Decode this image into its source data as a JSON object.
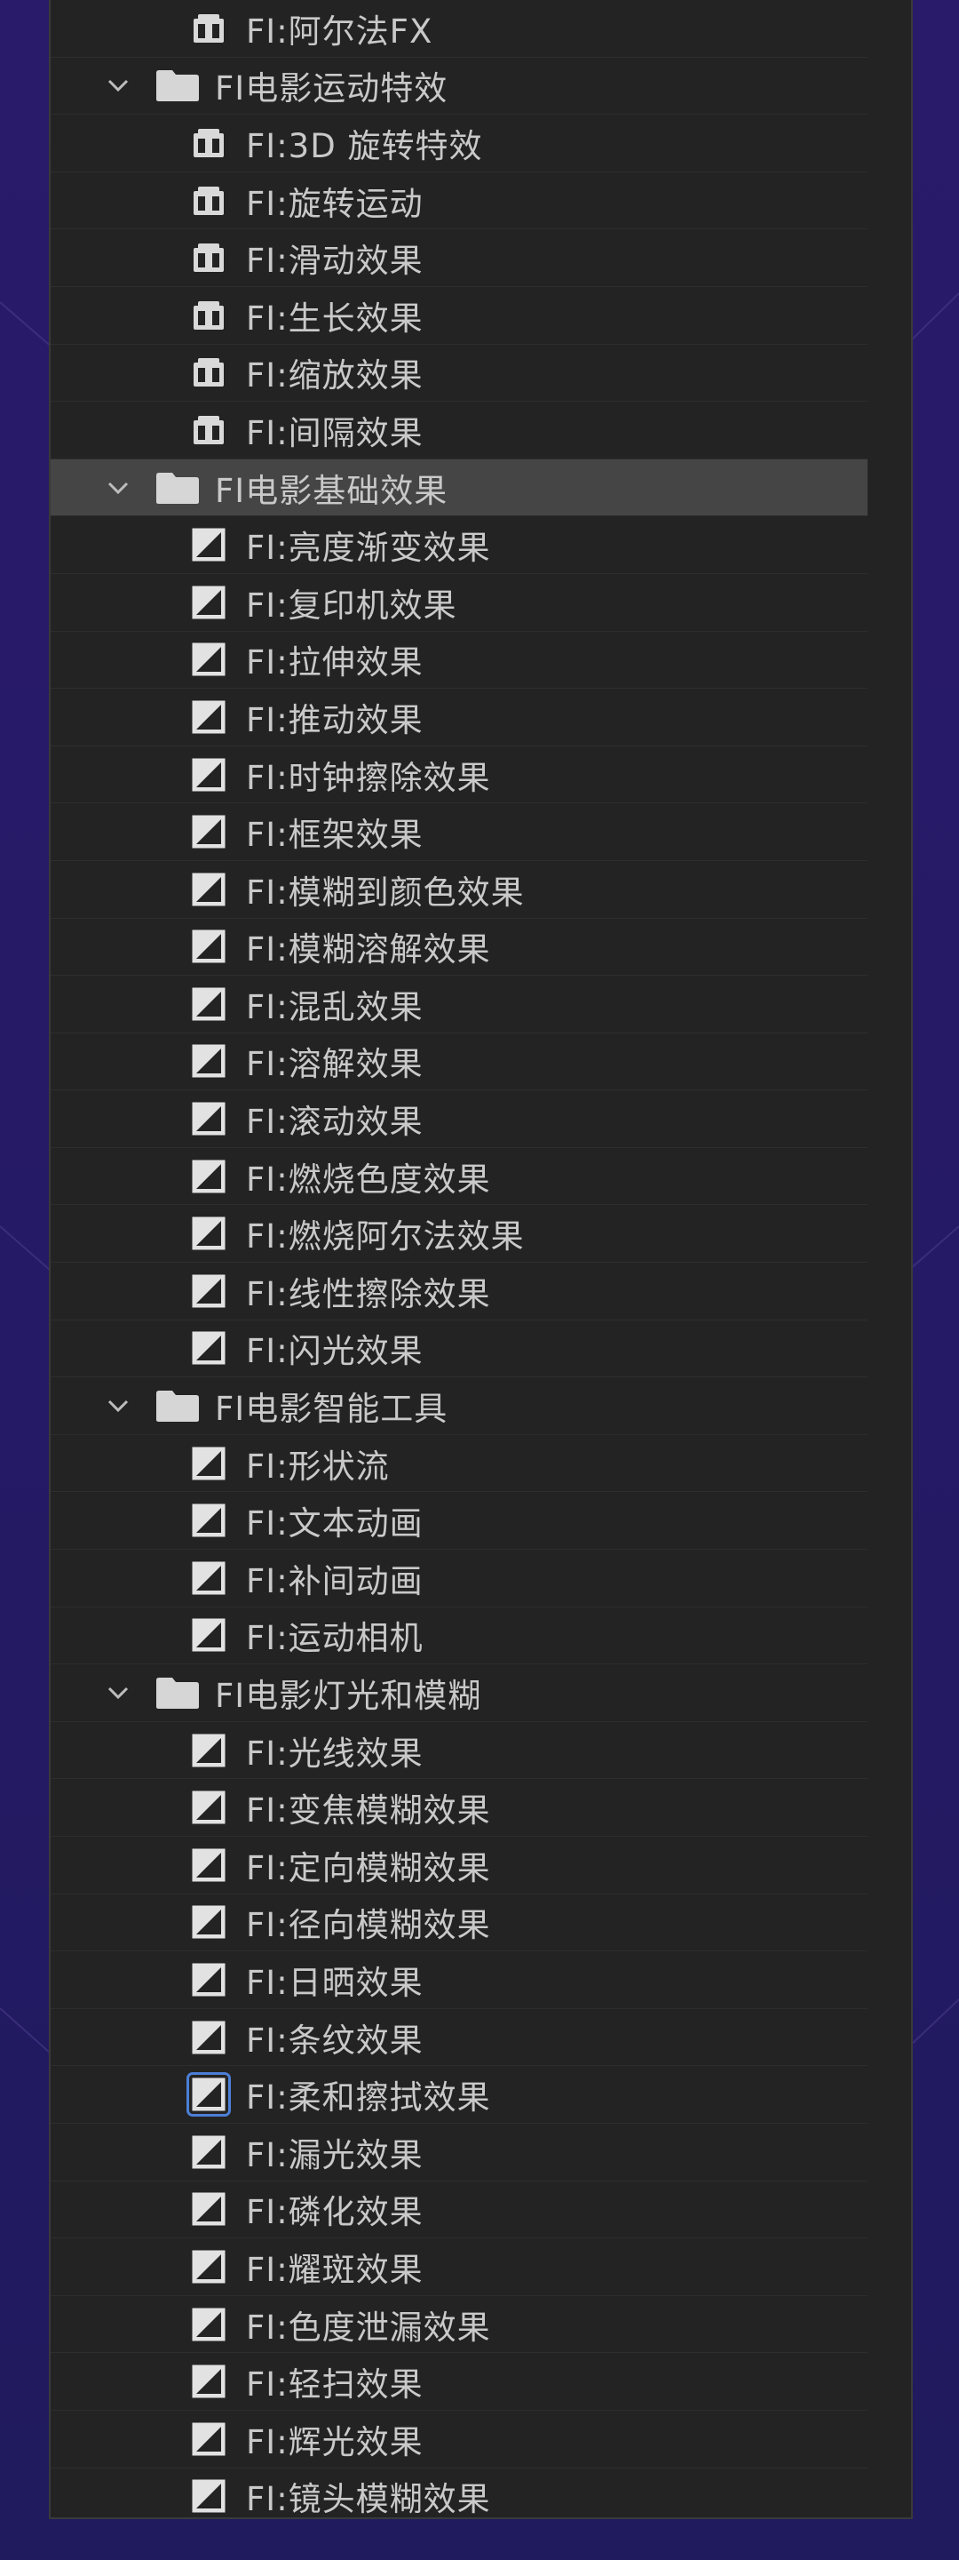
{
  "rows": [
    {
      "type": "item",
      "icon": "preset-bundle-icon",
      "label": "FI:阿尔法FX"
    },
    {
      "type": "folder",
      "label": "FI电影运动特效"
    },
    {
      "type": "item",
      "icon": "preset-bundle-icon",
      "label": "FI:3D 旋转特效"
    },
    {
      "type": "item",
      "icon": "preset-bundle-icon",
      "label": "FI:旋转运动"
    },
    {
      "type": "item",
      "icon": "preset-bundle-icon",
      "label": "FI:滑动效果"
    },
    {
      "type": "item",
      "icon": "preset-bundle-icon",
      "label": "FI:生长效果"
    },
    {
      "type": "item",
      "icon": "preset-bundle-icon",
      "label": "FI:缩放效果"
    },
    {
      "type": "item",
      "icon": "preset-bundle-icon",
      "label": "FI:间隔效果"
    },
    {
      "type": "folder",
      "label": "FI电影基础效果",
      "selected": true
    },
    {
      "type": "item",
      "icon": "transition-icon",
      "label": "FI:亮度渐变效果"
    },
    {
      "type": "item",
      "icon": "transition-icon",
      "label": "FI:复印机效果"
    },
    {
      "type": "item",
      "icon": "transition-icon",
      "label": "FI:拉伸效果"
    },
    {
      "type": "item",
      "icon": "transition-icon",
      "label": "FI:推动效果"
    },
    {
      "type": "item",
      "icon": "transition-icon",
      "label": "FI:时钟擦除效果"
    },
    {
      "type": "item",
      "icon": "transition-icon",
      "label": "FI:框架效果"
    },
    {
      "type": "item",
      "icon": "transition-icon",
      "label": "FI:模糊到颜色效果"
    },
    {
      "type": "item",
      "icon": "transition-icon",
      "label": "FI:模糊溶解效果"
    },
    {
      "type": "item",
      "icon": "transition-icon",
      "label": "FI:混乱效果"
    },
    {
      "type": "item",
      "icon": "transition-icon",
      "label": "FI:溶解效果"
    },
    {
      "type": "item",
      "icon": "transition-icon",
      "label": "FI:滚动效果"
    },
    {
      "type": "item",
      "icon": "transition-icon",
      "label": "FI:燃烧色度效果"
    },
    {
      "type": "item",
      "icon": "transition-icon",
      "label": "FI:燃烧阿尔法效果"
    },
    {
      "type": "item",
      "icon": "transition-icon",
      "label": "FI:线性擦除效果"
    },
    {
      "type": "item",
      "icon": "transition-icon",
      "label": "FI:闪光效果"
    },
    {
      "type": "folder",
      "label": "FI电影智能工具"
    },
    {
      "type": "item",
      "icon": "transition-icon",
      "label": "FI:形状流"
    },
    {
      "type": "item",
      "icon": "transition-icon",
      "label": "FI:文本动画"
    },
    {
      "type": "item",
      "icon": "transition-icon",
      "label": "FI:补间动画"
    },
    {
      "type": "item",
      "icon": "transition-icon",
      "label": "FI:运动相机"
    },
    {
      "type": "folder",
      "label": "FI电影灯光和模糊"
    },
    {
      "type": "item",
      "icon": "transition-icon",
      "label": "FI:光线效果"
    },
    {
      "type": "item",
      "icon": "transition-icon",
      "label": "FI:变焦模糊效果"
    },
    {
      "type": "item",
      "icon": "transition-icon",
      "label": "FI:定向模糊效果"
    },
    {
      "type": "item",
      "icon": "transition-icon",
      "label": "FI:径向模糊效果"
    },
    {
      "type": "item",
      "icon": "transition-icon",
      "label": "FI:日晒效果"
    },
    {
      "type": "item",
      "icon": "transition-icon",
      "label": "FI:条纹效果"
    },
    {
      "type": "item",
      "icon": "transition-icon",
      "label": "FI:柔和擦拭效果",
      "icon_selected": true
    },
    {
      "type": "item",
      "icon": "transition-icon",
      "label": "FI:漏光效果"
    },
    {
      "type": "item",
      "icon": "transition-icon",
      "label": "FI:磷化效果"
    },
    {
      "type": "item",
      "icon": "transition-icon",
      "label": "FI:耀斑效果"
    },
    {
      "type": "item",
      "icon": "transition-icon",
      "label": "FI:色度泄漏效果"
    },
    {
      "type": "item",
      "icon": "transition-icon",
      "label": "FI:轻扫效果"
    },
    {
      "type": "item",
      "icon": "transition-icon",
      "label": "FI:辉光效果"
    },
    {
      "type": "item",
      "icon": "transition-icon",
      "label": "FI:镜头模糊效果"
    }
  ],
  "colors": {
    "background": "#2a1a6a",
    "panel": "#232323",
    "row_selected": "#454545",
    "text": "#c9c9c9",
    "focus_outline": "#4c7fd6"
  }
}
